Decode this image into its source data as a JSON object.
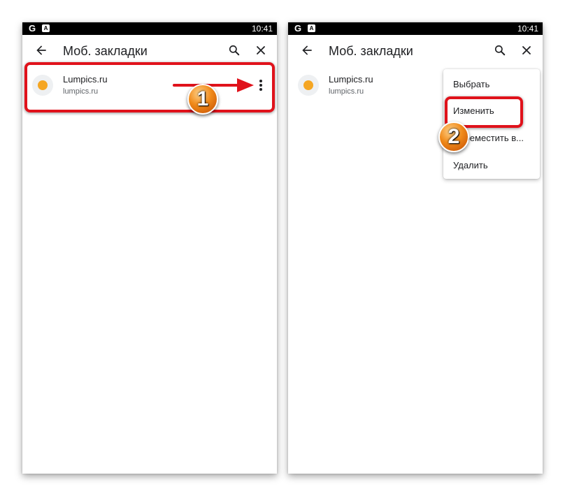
{
  "screens": [
    {
      "status_bar": {
        "left_icon_g": "G",
        "left_icon_a": "A",
        "time": "10:41"
      },
      "app_bar": {
        "title": "Моб. закладки",
        "icons": [
          "back-arrow-icon",
          "search-icon",
          "close-icon"
        ]
      },
      "bookmark": {
        "title": "Lumpics.ru",
        "url": "lumpics.ru",
        "favicon": "orange-globe-icon"
      }
    },
    {
      "status_bar": {
        "left_icon_g": "G",
        "left_icon_a": "A",
        "time": "10:41"
      },
      "app_bar": {
        "title": "Моб. закладки",
        "icons": [
          "back-arrow-icon",
          "search-icon",
          "close-icon"
        ]
      },
      "bookmark": {
        "title": "Lumpics.ru",
        "url": "lumpics.ru",
        "favicon": "orange-globe-icon"
      },
      "menu": {
        "items": [
          "Выбрать",
          "Изменить",
          "Переместить в...",
          "Удалить"
        ]
      }
    }
  ],
  "annotations": {
    "step_1": "1",
    "step_2": "2",
    "highlight_color": "#e0121b",
    "badge_color": "#f08a1a"
  },
  "colors": {
    "text_primary": "#202124",
    "text_secondary": "#5f6368",
    "favicon": "#f5a623"
  }
}
